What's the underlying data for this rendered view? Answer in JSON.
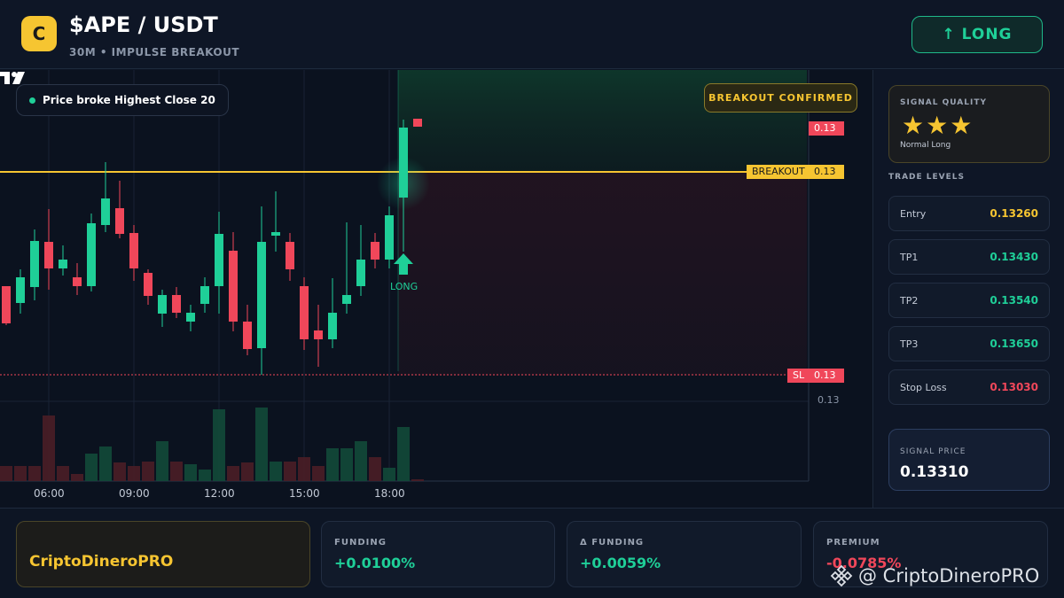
{
  "header": {
    "logo_letter": "C",
    "title": "$APE / USDT",
    "subtitle": "30M • IMPULSE BREAKOUT",
    "direction_label": "↑ LONG"
  },
  "chart": {
    "note": "Price broke Highest Close 20",
    "status_badge": "BREAKOUT CONFIRMED",
    "price_tag_top": "0.13",
    "breakout_label": "BREAKOUT",
    "breakout_price": "0.13",
    "sl_label": "SL",
    "sl_price": "0.13",
    "axis_price": "0.13",
    "signal_marker_label": "LONG",
    "time_labels": [
      "06:00",
      "09:00",
      "12:00",
      "15:00",
      "18:00"
    ],
    "colors": {
      "up": "#1fcf98",
      "down": "#f0475a",
      "breakout": "#f6c531"
    }
  },
  "right_panel": {
    "quality_title": "SIGNAL QUALITY",
    "stars": "★★★",
    "quality_sub": "Normal Long",
    "trade_levels_title": "TRADE LEVELS",
    "levels": [
      {
        "label": "Entry",
        "value": "0.13260",
        "color": "#f6c531"
      },
      {
        "label": "TP1",
        "value": "0.13430",
        "color": "#1fcf98"
      },
      {
        "label": "TP2",
        "value": "0.13540",
        "color": "#1fcf98"
      },
      {
        "label": "TP3",
        "value": "0.13650",
        "color": "#1fcf98"
      },
      {
        "label": "Stop Loss",
        "value": "0.13030",
        "color": "#f0475a"
      }
    ],
    "signal_price_label": "SIGNAL PRICE",
    "signal_price_value": "0.13310"
  },
  "footer": {
    "brand": "CriptoDineroPRO",
    "stats": [
      {
        "label": "FUNDING",
        "value": "+0.0100%",
        "color": "#1fcf98"
      },
      {
        "label": "Δ FUNDING",
        "value": "+0.0059%",
        "color": "#1fcf98"
      },
      {
        "label": "PREMIUM",
        "value": "-0.0785%",
        "color": "#f0475a"
      }
    ],
    "watermark": "@ CriptoDineroPRO"
  }
}
